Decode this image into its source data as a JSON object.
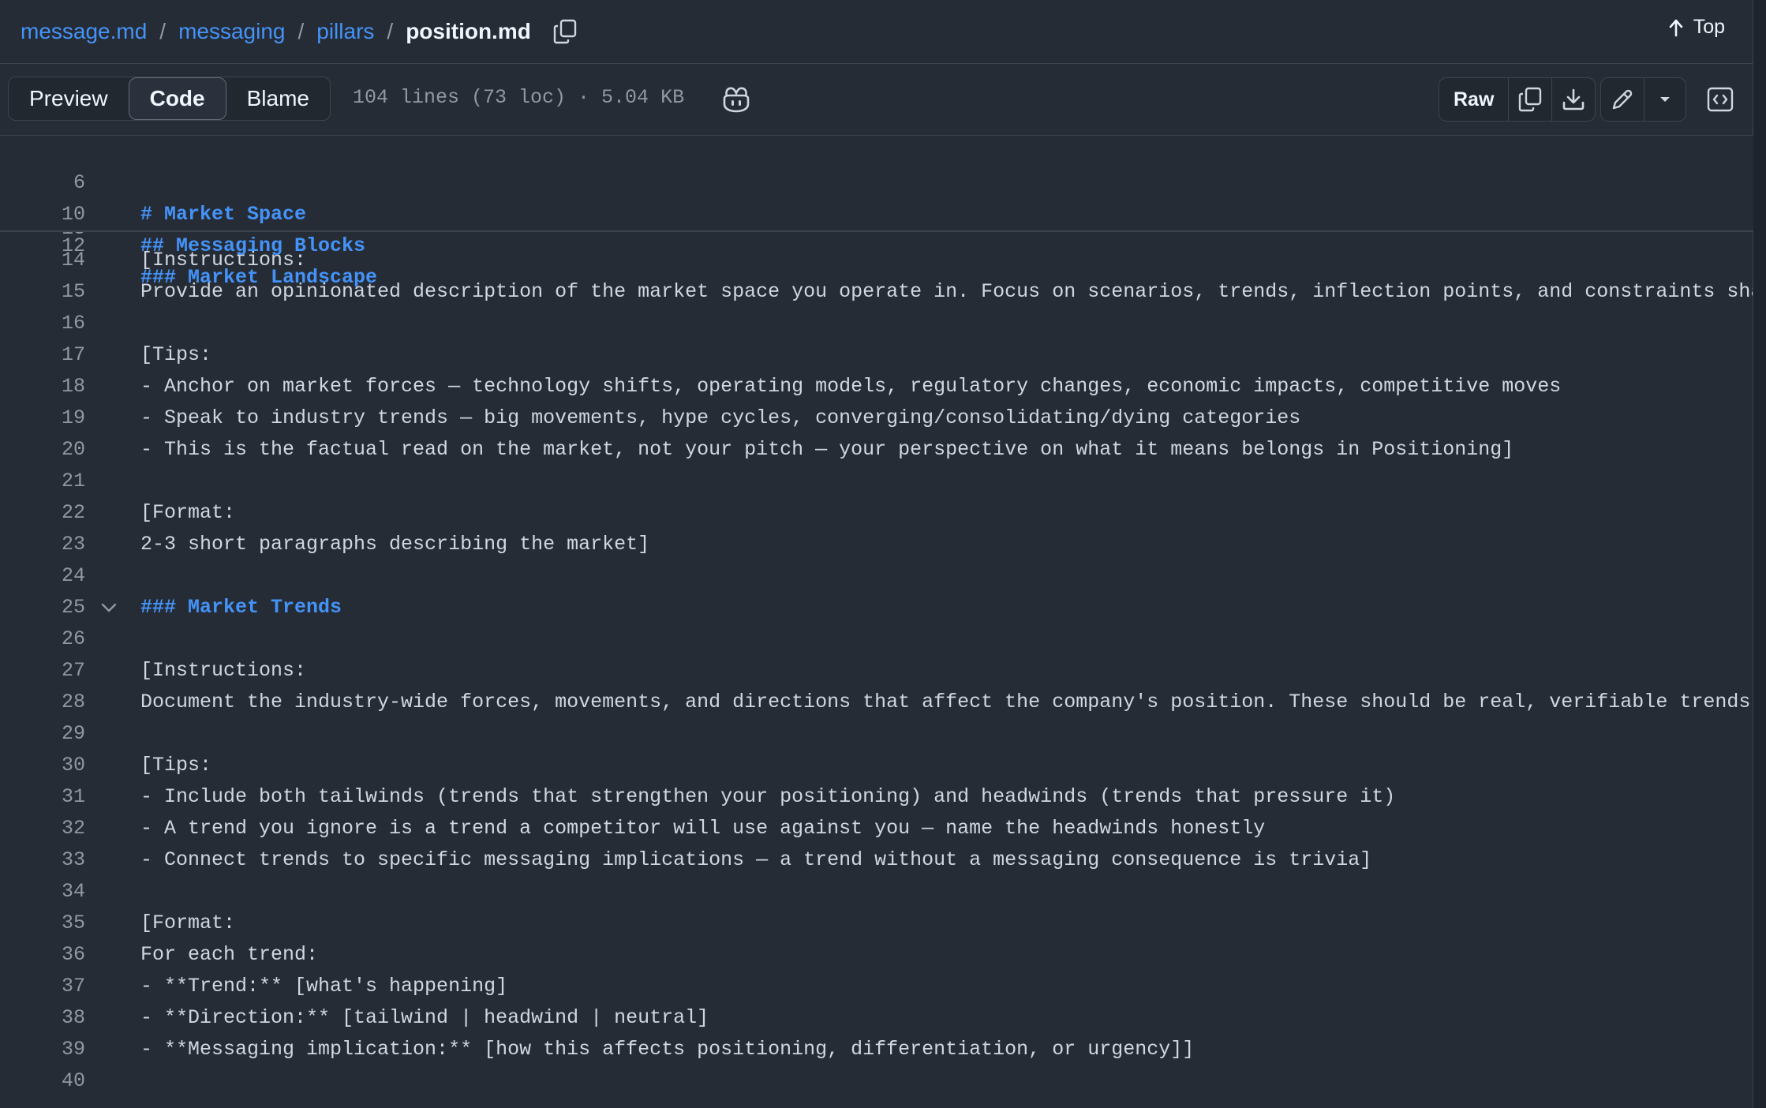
{
  "breadcrumb": {
    "items": [
      "message.md",
      "messaging",
      "pillars"
    ],
    "separator": "/",
    "current": "position.md"
  },
  "top_link": "Top",
  "view_tabs": [
    "Preview",
    "Code",
    "Blame"
  ],
  "active_tab": "Code",
  "file_info": "104 lines (73 loc) · 5.04 KB",
  "toolbar": {
    "raw_label": "Raw"
  },
  "sticky_lines": [
    {
      "num": "6",
      "text": "# Market Space"
    },
    {
      "num": "10",
      "text": "## Messaging Blocks"
    },
    {
      "num": "12",
      "text": "### Market Landscape"
    }
  ],
  "code_lines": [
    {
      "num": "13",
      "text": ""
    },
    {
      "num": "14",
      "text": "[Instructions:"
    },
    {
      "num": "15",
      "text": "Provide an opinionated description of the market space you operate in. Focus on scenarios, trends, inflection points, and constraints shaping"
    },
    {
      "num": "16",
      "text": ""
    },
    {
      "num": "17",
      "text": "[Tips:"
    },
    {
      "num": "18",
      "text": "- Anchor on market forces — technology shifts, operating models, regulatory changes, economic impacts, competitive moves"
    },
    {
      "num": "19",
      "text": "- Speak to industry trends — big movements, hype cycles, converging/consolidating/dying categories"
    },
    {
      "num": "20",
      "text": "- This is the factual read on the market, not your pitch — your perspective on what it means belongs in Positioning]"
    },
    {
      "num": "21",
      "text": ""
    },
    {
      "num": "22",
      "text": "[Format:"
    },
    {
      "num": "23",
      "text": "2-3 short paragraphs describing the market]"
    },
    {
      "num": "24",
      "text": ""
    },
    {
      "num": "25",
      "text": "### Market Trends",
      "heading": true,
      "fold": true
    },
    {
      "num": "26",
      "text": ""
    },
    {
      "num": "27",
      "text": "[Instructions:"
    },
    {
      "num": "28",
      "text": "Document the industry-wide forces, movements, and directions that affect the company's position. These should be real, verifiable trends — not"
    },
    {
      "num": "29",
      "text": ""
    },
    {
      "num": "30",
      "text": "[Tips:"
    },
    {
      "num": "31",
      "text": "- Include both tailwinds (trends that strengthen your positioning) and headwinds (trends that pressure it)"
    },
    {
      "num": "32",
      "text": "- A trend you ignore is a trend a competitor will use against you — name the headwinds honestly"
    },
    {
      "num": "33",
      "text": "- Connect trends to specific messaging implications — a trend without a messaging consequence is trivia]"
    },
    {
      "num": "34",
      "text": ""
    },
    {
      "num": "35",
      "text": "[Format:"
    },
    {
      "num": "36",
      "text": "For each trend:"
    },
    {
      "num": "37",
      "text": "- **Trend:** [what's happening]"
    },
    {
      "num": "38",
      "text": "- **Direction:** [tailwind | headwind | neutral]"
    },
    {
      "num": "39",
      "text": "- **Messaging implication:** [how this affects positioning, differentiation, or urgency]]"
    },
    {
      "num": "40",
      "text": ""
    }
  ],
  "colors": {
    "background": "#262c36",
    "link": "#4493f8",
    "text": "#d1d7e0",
    "muted": "#9198a1",
    "border": "#3d444d"
  }
}
